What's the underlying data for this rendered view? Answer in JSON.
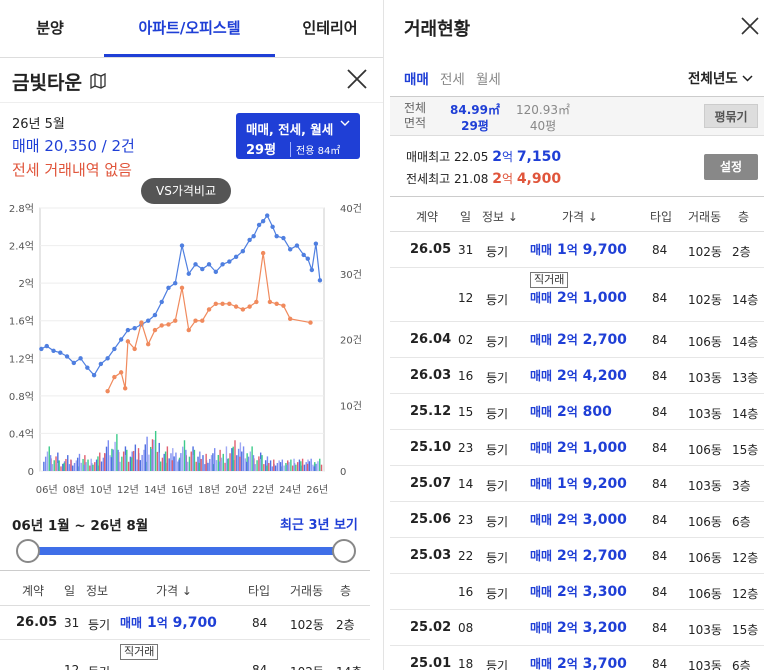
{
  "nav": {
    "tabs": [
      "분양",
      "아파트/오피스텔",
      "인테리어"
    ],
    "active": 1
  },
  "complex": {
    "name": "금빛타운"
  },
  "summary": {
    "period": "26년 5월",
    "sale_label": "매매",
    "sale_value": "20,350 / 2건",
    "rent_text": "전세 거래내역 없음"
  },
  "filter": {
    "types": "매매, 전세, 월세",
    "size": "29평",
    "area": "전용 84㎡"
  },
  "compare_button": "VS가격비교",
  "chart_data": {
    "type": "line",
    "x_ticks": [
      "06년",
      "08년",
      "10년",
      "12년",
      "14년",
      "16년",
      "18년",
      "20년",
      "22년",
      "24년",
      "26년"
    ],
    "y_left_ticks": [
      "0",
      "0.4억",
      "0.8억",
      "1.2억",
      "1.6억",
      "2억",
      "2.4억",
      "2.8억"
    ],
    "y_left_range": [
      0,
      2.8
    ],
    "y_right_ticks": [
      "0",
      "10건",
      "20건",
      "30건",
      "40건"
    ],
    "y_right_range": [
      0,
      40
    ],
    "x_range": [
      2005.5,
      2026.5
    ],
    "series": [
      {
        "color": "#4f7fe0",
        "x": [
          2005.6,
          2006.0,
          2006.5,
          2007.0,
          2007.5,
          2008.0,
          2008.5,
          2009.0,
          2009.5,
          2010.0,
          2010.5,
          2011.0,
          2011.5,
          2012.0,
          2012.5,
          2013.0,
          2013.5,
          2014.0,
          2014.5,
          2015.0,
          2015.5,
          2016.0,
          2016.5,
          2017.0,
          2017.5,
          2018.0,
          2018.5,
          2019.0,
          2019.5,
          2020.0,
          2020.5,
          2021.0,
          2021.3,
          2021.7,
          2022.0,
          2022.3,
          2022.7,
          2023.0,
          2023.5,
          2024.0,
          2024.5,
          2025.0,
          2025.3,
          2025.6,
          2025.9,
          2026.2
        ],
        "y": [
          1.3,
          1.33,
          1.28,
          1.26,
          1.22,
          1.15,
          1.2,
          1.1,
          1.02,
          1.14,
          1.2,
          1.3,
          1.4,
          1.5,
          1.52,
          1.56,
          1.6,
          1.66,
          1.8,
          1.95,
          2.0,
          2.4,
          2.1,
          2.2,
          2.15,
          2.2,
          2.12,
          2.2,
          2.23,
          2.28,
          2.34,
          2.46,
          2.5,
          2.62,
          2.66,
          2.72,
          2.6,
          2.5,
          2.48,
          2.36,
          2.4,
          2.3,
          2.26,
          2.14,
          2.42,
          2.03
        ]
      },
      {
        "color": "#f08a5d",
        "x": [
          2010.5,
          2011.0,
          2011.5,
          2011.8,
          2012.0,
          2012.5,
          2013.0,
          2013.5,
          2014.0,
          2014.5,
          2015.0,
          2015.5,
          2016.0,
          2016.5,
          2017.0,
          2017.5,
          2018.0,
          2018.5,
          2019.0,
          2019.5,
          2020.0,
          2020.5,
          2021.0,
          2021.5,
          2022.0,
          2022.5,
          2023.0,
          2023.5,
          2024.0,
          2025.5
        ],
        "y": [
          0.85,
          1.0,
          1.05,
          0.88,
          1.38,
          1.3,
          1.58,
          1.35,
          1.5,
          1.55,
          1.56,
          1.6,
          1.95,
          1.5,
          1.6,
          1.6,
          1.72,
          1.78,
          1.78,
          1.78,
          1.75,
          1.72,
          1.75,
          1.8,
          2.32,
          1.8,
          1.78,
          1.76,
          1.62,
          1.58
        ]
      }
    ],
    "volume": {
      "x": [
        2006,
        2006.5,
        2007,
        2007.5,
        2008,
        2008.5,
        2009,
        2009.5,
        2010,
        2010.5,
        2011,
        2011.5,
        2012,
        2012.5,
        2013,
        2013.5,
        2014,
        2014.5,
        2015,
        2015.5,
        2016,
        2016.5,
        2017,
        2017.5,
        2018,
        2018.5,
        2019,
        2019.5,
        2020,
        2020.5,
        2021,
        2021.5,
        2022,
        2022.5,
        2023,
        2023.5,
        2024,
        2024.5,
        2025,
        2025.5,
        2026
      ],
      "count": [
        4,
        3,
        2,
        3,
        2,
        3,
        2,
        2,
        3,
        5,
        6,
        4,
        4,
        5,
        4,
        6,
        7,
        3,
        4,
        3,
        5,
        4,
        4,
        3,
        3,
        4,
        3,
        4,
        5,
        4,
        4,
        3,
        3,
        2,
        2,
        2,
        2,
        2,
        2,
        2,
        2
      ]
    }
  },
  "range": {
    "text": "06년 1월 ~ 26년 8월",
    "button": "최근 3년 보기",
    "start": 0,
    "end": 1
  },
  "table_headers": {
    "contract": "계약",
    "day": "일",
    "info": "정보",
    "price": "가격",
    "type": "타입",
    "building": "거래동",
    "floor": "층"
  },
  "left_rows": [
    {
      "date": "26.05",
      "day": "31",
      "info": "등기",
      "badge": "",
      "kind": "매매",
      "price_a": "1",
      "unit_a": "억",
      "price_b": "9,700",
      "type": "84",
      "building": "102동",
      "floor": "2층"
    },
    {
      "date": "",
      "day": "12",
      "info": "등기",
      "badge": "직거래",
      "kind": "",
      "price_a": "",
      "unit_a": "",
      "price_b": "",
      "type": "84",
      "building": "102동",
      "floor": "14층"
    }
  ],
  "right": {
    "title": "거래현황",
    "tabs": [
      "매매",
      "전세",
      "월세"
    ],
    "year": "전체년도",
    "area_label_1": "전체",
    "area_label_2": "면적",
    "area_a_m2": "84.99㎡",
    "area_a_py": "29평",
    "area_b_m2": "120.93㎡",
    "area_b_py": "40평",
    "pyeong_button": "평묶기",
    "max_sale_label": "매매최고",
    "max_sale_date": "22.05",
    "max_sale_a": "2",
    "max_sale_unit": "억",
    "max_sale_b": "7,150",
    "max_rent_label": "전세최고",
    "max_rent_date": "21.08",
    "max_rent_a": "2",
    "max_rent_unit": "억",
    "max_rent_b": "4,900",
    "setting_button": "설정",
    "rows": [
      {
        "date": "26.05",
        "day": "31",
        "info": "등기",
        "badge": "",
        "kind": "매매",
        "a": "1",
        "u": "억",
        "b": "9,700",
        "type": "84",
        "building": "102동",
        "floor": "2층"
      },
      {
        "date": "",
        "day": "12",
        "info": "등기",
        "badge": "직거래",
        "kind": "매매",
        "a": "2",
        "u": "억",
        "b": "1,000",
        "type": "84",
        "building": "102동",
        "floor": "14층"
      },
      {
        "date": "26.04",
        "day": "02",
        "info": "등기",
        "badge": "",
        "kind": "매매",
        "a": "2",
        "u": "억",
        "b": "2,700",
        "type": "84",
        "building": "106동",
        "floor": "14층"
      },
      {
        "date": "26.03",
        "day": "16",
        "info": "등기",
        "badge": "",
        "kind": "매매",
        "a": "2",
        "u": "억",
        "b": "4,200",
        "type": "84",
        "building": "103동",
        "floor": "13층"
      },
      {
        "date": "25.12",
        "day": "15",
        "info": "등기",
        "badge": "",
        "kind": "매매",
        "a": "2",
        "u": "억",
        "b": "800",
        "type": "84",
        "building": "103동",
        "floor": "14층"
      },
      {
        "date": "25.10",
        "day": "23",
        "info": "등기",
        "badge": "",
        "kind": "매매",
        "a": "2",
        "u": "억",
        "b": "1,000",
        "type": "84",
        "building": "106동",
        "floor": "15층"
      },
      {
        "date": "25.07",
        "day": "14",
        "info": "등기",
        "badge": "",
        "kind": "매매",
        "a": "1",
        "u": "억",
        "b": "9,200",
        "type": "84",
        "building": "103동",
        "floor": "3층"
      },
      {
        "date": "25.06",
        "day": "23",
        "info": "등기",
        "badge": "",
        "kind": "매매",
        "a": "2",
        "u": "억",
        "b": "3,000",
        "type": "84",
        "building": "106동",
        "floor": "6층"
      },
      {
        "date": "25.03",
        "day": "22",
        "info": "등기",
        "badge": "",
        "kind": "매매",
        "a": "2",
        "u": "억",
        "b": "2,700",
        "type": "84",
        "building": "106동",
        "floor": "12층"
      },
      {
        "date": "",
        "day": "16",
        "info": "등기",
        "badge": "",
        "kind": "매매",
        "a": "2",
        "u": "억",
        "b": "3,300",
        "type": "84",
        "building": "106동",
        "floor": "12층"
      },
      {
        "date": "25.02",
        "day": "08",
        "info": "",
        "badge": "",
        "kind": "매매",
        "a": "2",
        "u": "억",
        "b": "3,200",
        "type": "84",
        "building": "103동",
        "floor": "15층"
      },
      {
        "date": "25.01",
        "day": "18",
        "info": "등기",
        "badge": "",
        "kind": "매매",
        "a": "2",
        "u": "억",
        "b": "3,700",
        "type": "84",
        "building": "103동",
        "floor": "6층"
      }
    ]
  }
}
